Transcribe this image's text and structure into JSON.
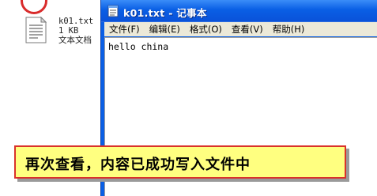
{
  "desktop": {
    "file": {
      "name": "k01.txt",
      "size": "1 KB",
      "type": "文本文档"
    }
  },
  "notepad": {
    "title": "k01.txt - 记事本",
    "menu": [
      "文件(F)",
      "编辑(E)",
      "格式(O)",
      "查看(V)",
      "帮助(H)"
    ],
    "content": "hello china"
  },
  "annotation": {
    "text": "再次查看，内容已成功写入文件中"
  },
  "colors": {
    "titlebar_blue": "#0a5fe5",
    "menu_bg": "#ece9d8",
    "callout_bg": "#ffff80",
    "callout_border": "#d9322a"
  }
}
